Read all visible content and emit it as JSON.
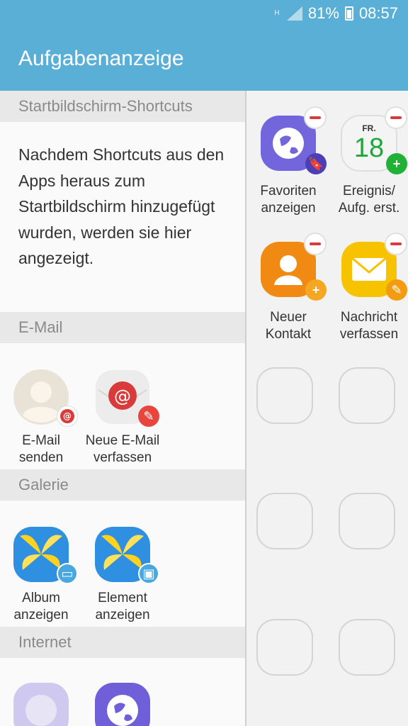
{
  "status_bar": {
    "network": "H",
    "battery": "81%",
    "time": "08:57"
  },
  "app_bar": {
    "title": "Aufgabenanzeige"
  },
  "left_pane": {
    "sections": [
      {
        "title": "Startbildschirm-Shortcuts"
      },
      {
        "title": "E-Mail"
      },
      {
        "title": "Galerie"
      },
      {
        "title": "Internet"
      }
    ],
    "description": "Nachdem Shortcuts aus den Apps heraus zum Startbildschirm hinzugefügt wurden, werden sie hier angezeigt.",
    "email_items": [
      {
        "label": "E-Mail senden",
        "icon": "contact-icon"
      },
      {
        "label": "Neue E-Mail verfassen",
        "icon": "email-icon"
      }
    ],
    "gallery_items": [
      {
        "label": "Album anzeigen",
        "icon": "gallery-icon"
      },
      {
        "label": "Element anzeigen",
        "icon": "gallery-icon"
      }
    ]
  },
  "right_pane": {
    "shortcuts": [
      {
        "label": "Favoriten anzeigen",
        "icon": "internet-icon"
      },
      {
        "label": "Ereignis/ Aufg. erst.",
        "icon": "calendar-icon",
        "calendar_day": "FR.",
        "calendar_date": "18"
      },
      {
        "label": "Neuer Kontakt",
        "icon": "contacts-icon"
      },
      {
        "label": "Nachricht verfassen",
        "icon": "message-icon"
      }
    ],
    "empty_slots": 6
  },
  "colors": {
    "accent": "#5aafd6",
    "remove": "#d93a3a"
  }
}
